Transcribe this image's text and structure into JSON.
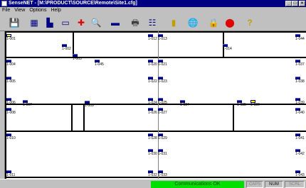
{
  "window": {
    "title": "SenseNET - [M:\\PRODUCT\\SOURCE\\Remote\\Site1.cfg]"
  },
  "menu": [
    "File",
    "View",
    "Options",
    "Help"
  ],
  "toolbar": [
    {
      "name": "save-icon",
      "glyph": "💾"
    },
    {
      "name": "grid-icon",
      "glyph": "▦"
    },
    {
      "name": "chart-icon",
      "glyph": "▙"
    },
    {
      "name": "screen-icon",
      "glyph": "▭"
    },
    {
      "name": "add-icon",
      "glyph": "✚"
    },
    {
      "name": "zoom-icon",
      "glyph": "🔍"
    },
    {
      "name": "panel-icon",
      "glyph": "▬"
    },
    {
      "name": "printer-icon",
      "glyph": "🖶"
    },
    {
      "name": "tree-icon",
      "glyph": "☷"
    },
    {
      "name": "device-icon",
      "glyph": "▮"
    },
    {
      "name": "globe-icon",
      "glyph": "🌐"
    },
    {
      "name": "lock-icon",
      "glyph": "🔒"
    },
    {
      "name": "stop-icon",
      "glyph": "⬤"
    },
    {
      "name": "help-icon",
      "glyph": "?"
    }
  ],
  "nodes": [
    "1-001",
    "1-002",
    "1-003",
    "1-004",
    "1-005",
    "1-006",
    "1-007",
    "1-008",
    "1-009",
    "1-010",
    "1-011",
    "1-012",
    "1-013",
    "1-014",
    "1-020",
    "1-021",
    "1-022",
    "1-023",
    "1-024",
    "1-025",
    "1-026",
    "1-027",
    "1-028",
    "1-029",
    "1-030",
    "1-031",
    "1-032",
    "1-033",
    "1-034",
    "1-035",
    "1-036",
    "1-037",
    "1-038",
    "1-039",
    "1-040",
    "1-041",
    "1-042",
    "1-043",
    "1-044",
    "1-045"
  ],
  "status": {
    "comms": "Communications OK",
    "caps": "CAPS",
    "num": "NUM",
    "scrl": "SCRL"
  },
  "colors": {
    "titlebar": "#000080",
    "comms_ok": "#00e000",
    "canvas": "#ffffff"
  }
}
